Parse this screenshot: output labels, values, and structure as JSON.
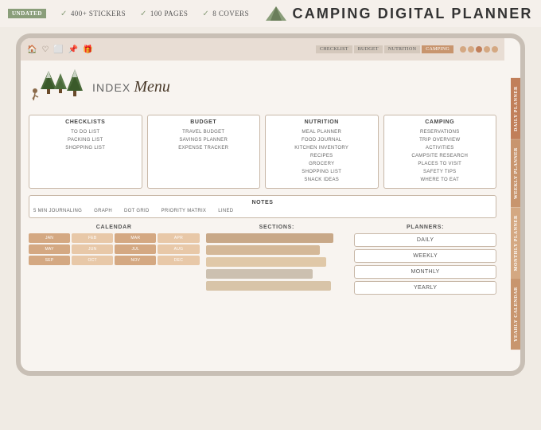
{
  "badge": {
    "label": "UNDATED"
  },
  "features": [
    {
      "icon": "✓",
      "text": "400+ STICKERS"
    },
    {
      "icon": "✓",
      "text": "100 PAGES"
    },
    {
      "icon": "✓",
      "text": "8 COVERS"
    }
  ],
  "title": "CAMPING DIGITAL PLANNER",
  "nav": {
    "icons": [
      "🏠",
      "♡",
      "⬜",
      "📌",
      "🎁"
    ],
    "tabs": [
      "CHECKLIST",
      "BUDGET",
      "NUTRITION",
      "CAMPING"
    ],
    "dots": 5
  },
  "index": {
    "label": "INDEX",
    "menu": "Menu"
  },
  "sections": [
    {
      "title": "CHECKLISTS",
      "items": [
        "TO DO LIST",
        "PACKING LIST",
        "SHOPPING LIST"
      ]
    },
    {
      "title": "BUDGET",
      "items": [
        "TRAVEL BUDGET",
        "SAVINGS PLANNER",
        "EXPENSE TRACKER"
      ]
    },
    {
      "title": "NUTRITION",
      "items": [
        "MEAL PLANNER",
        "FOOD JOURNAL",
        "KITCHEN INVENTORY",
        "RECIPES",
        "GROCERY",
        "SHOPPING LIST",
        "SNACK IDEAS"
      ]
    },
    {
      "title": "CAMPING",
      "items": [
        "RESERVATIONS",
        "TRIP OVERVIEW",
        "ACTIVITIES",
        "CAMPSITE RESEARCH",
        "PLACES TO VISIT",
        "SAFETY TIPS",
        "WHERE TO EAT"
      ]
    }
  ],
  "notes": {
    "title": "NOTES",
    "items": [
      "5 MIN JOURNALING",
      "GRAPH",
      "DOT GRID",
      "PRIORITY MATRIX",
      "LINED"
    ]
  },
  "calendar": {
    "label": "CALENDAR",
    "months": [
      "JAN",
      "FEB",
      "MAR",
      "APR",
      "MAY",
      "JUN",
      "JUL",
      "AUG",
      "SEP",
      "OCT",
      "NOV",
      "DEC"
    ]
  },
  "sections_label": "SECTIONS:",
  "planners": {
    "label": "PLANNERS:",
    "items": [
      "DAILY",
      "WEEKLY",
      "MONTHLY",
      "YEARLY"
    ]
  },
  "right_tabs": [
    "DAILY PLANNER",
    "WEEKLY PLANNER",
    "MONTHLY PLANNER",
    "YEARLY CALENDAR"
  ]
}
